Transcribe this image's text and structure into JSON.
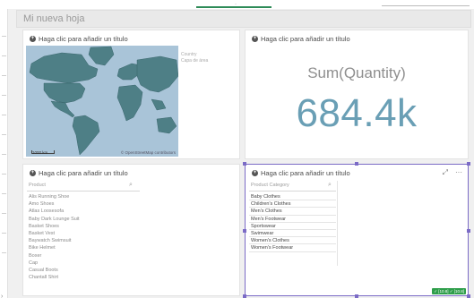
{
  "sheet": {
    "title": "Mi nueva hoja"
  },
  "map": {
    "title": "Haga clic para añadir un título",
    "legend": [
      "Country",
      "Capa de área"
    ],
    "scale": "1000 km",
    "copyright": "© OpenStreetMap contributors"
  },
  "kpi": {
    "title": "Haga clic para añadir un título",
    "label": "Sum(Quantity)",
    "value": "684.4k"
  },
  "products": {
    "title": "Haga clic para añadir un título",
    "field": "Product",
    "items": [
      "Alis Running Shoe",
      "Amo Shoes",
      "Atlas Loosesofa",
      "Baby Dark Lounge Suit",
      "Basket Shoes",
      "Basket Vest",
      "Baywatch Swimsuit",
      "Bike Helmet",
      "Boxer",
      "Cap",
      "Casual Boots",
      "Chantall Shirt"
    ]
  },
  "categories": {
    "title": "Haga clic para añadir un título",
    "field": "Product Category",
    "items": [
      "Baby Clothes",
      "Children's Clothes",
      "Men's Clothes",
      "Men's Footwear",
      "Sportswear",
      "Swimwear",
      "Women's Clothes",
      "Women's Footwear"
    ],
    "status": "✓ [10.8] ✓ [10.8]",
    "accent": "#7b6bc6"
  },
  "colors": {
    "kpi_value": "#6a9fb5",
    "map_land": "#4e7f86",
    "map_water": "#a9c4d8"
  }
}
